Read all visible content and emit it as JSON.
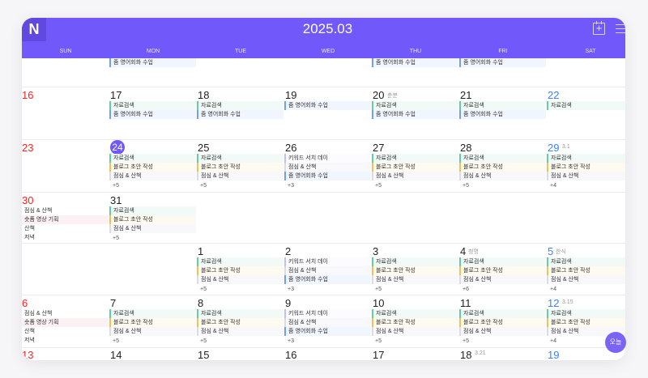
{
  "header": {
    "logo": "N",
    "title": "2025.03",
    "icons": [
      "calendar-plus-icon",
      "menu-icon"
    ]
  },
  "days_of_week": [
    "SUN",
    "MON",
    "TUE",
    "WED",
    "THU",
    "FRI",
    "SAT"
  ],
  "today_button": "오늘",
  "colors": {
    "accent": "#7158fb",
    "sunday": "#ff2020",
    "saturday": "#3b82f6"
  },
  "weeks": [
    {
      "partial": true,
      "cells": [
        {
          "events": []
        },
        {
          "events": [
            {
              "t": "줌 영어회화 수업",
              "c": "blue"
            }
          ]
        },
        {
          "events": []
        },
        {
          "events": []
        },
        {
          "events": [
            {
              "t": "줌 영어회화 수업",
              "c": "blue"
            }
          ]
        },
        {
          "events": [
            {
              "t": "줌 영어회화 수업",
              "c": "blue"
            }
          ]
        },
        {
          "events": []
        }
      ]
    },
    {
      "cells": [
        {
          "d": "16",
          "events": []
        },
        {
          "d": "17",
          "events": [
            {
              "t": "자료검색",
              "c": "green"
            },
            {
              "t": "줌 영어회화 수업",
              "c": "blue"
            }
          ]
        },
        {
          "d": "18",
          "events": [
            {
              "t": "자료검색",
              "c": "green"
            },
            {
              "t": "줌 영어회화 수업",
              "c": "blue"
            }
          ]
        },
        {
          "d": "19",
          "events": [
            {
              "t": "줌 영어회화 수업",
              "c": "blue"
            }
          ]
        },
        {
          "d": "20",
          "note": "춘분",
          "events": [
            {
              "t": "자료검색",
              "c": "green"
            },
            {
              "t": "줌 영어회화 수업",
              "c": "blue"
            }
          ]
        },
        {
          "d": "21",
          "events": [
            {
              "t": "자료검색",
              "c": "green"
            },
            {
              "t": "줌 영어회화 수업",
              "c": "blue"
            }
          ]
        },
        {
          "d": "22",
          "events": [
            {
              "t": "자료검색",
              "c": "green"
            }
          ]
        }
      ]
    },
    {
      "cells": [
        {
          "d": "23",
          "events": []
        },
        {
          "d": "24",
          "today": true,
          "events": [
            {
              "t": "자료검색",
              "c": "green"
            },
            {
              "t": "블로그 초안 작성",
              "c": "orange"
            },
            {
              "t": "점심 & 산책",
              "c": "gray"
            }
          ],
          "more": "+5"
        },
        {
          "d": "25",
          "events": [
            {
              "t": "자료검색",
              "c": "green"
            },
            {
              "t": "블로그 초안 작성",
              "c": "orange"
            },
            {
              "t": "점심 & 산책",
              "c": "gray"
            }
          ],
          "more": "+5"
        },
        {
          "d": "26",
          "events": [
            {
              "t": "키워드 서치 데이",
              "c": "purple"
            },
            {
              "t": "점심 & 산책",
              "c": "gray"
            },
            {
              "t": "줌 영어회화 수업",
              "c": "blue"
            }
          ],
          "more": "+3"
        },
        {
          "d": "27",
          "events": [
            {
              "t": "자료검색",
              "c": "green"
            },
            {
              "t": "블로그 초안 작성",
              "c": "orange"
            },
            {
              "t": "점심 & 산책",
              "c": "gray"
            }
          ],
          "more": "+5"
        },
        {
          "d": "28",
          "events": [
            {
              "t": "자료검색",
              "c": "green"
            },
            {
              "t": "블로그 초안 작성",
              "c": "orange"
            },
            {
              "t": "점심 & 산책",
              "c": "gray"
            }
          ],
          "more": "+5"
        },
        {
          "d": "29",
          "note": "3.1",
          "events": [
            {
              "t": "자료검색",
              "c": "green"
            },
            {
              "t": "블로그 초안 작성",
              "c": "orange"
            },
            {
              "t": "점심 & 산책",
              "c": "gray"
            }
          ],
          "more": "+4"
        }
      ]
    },
    {
      "cells": [
        {
          "d": "30",
          "events": [
            {
              "t": "점심 & 산책",
              "c": "plain"
            },
            {
              "t": "숏폼 영상 기획",
              "c": "pink"
            },
            {
              "t": "산책",
              "c": "plain"
            },
            {
              "t": "저녁",
              "c": "plain"
            }
          ]
        },
        {
          "d": "31",
          "events": [
            {
              "t": "자료검색",
              "c": "green"
            },
            {
              "t": "블로그 초안 작성",
              "c": "orange"
            },
            {
              "t": "점심 & 산책",
              "c": "gray"
            }
          ],
          "more": "+5"
        },
        {
          "events": []
        },
        {
          "events": []
        },
        {
          "events": []
        },
        {
          "events": []
        },
        {
          "events": []
        }
      ]
    },
    {
      "cells": [
        {
          "events": []
        },
        {
          "events": []
        },
        {
          "d": "1",
          "events": [
            {
              "t": "자료검색",
              "c": "green"
            },
            {
              "t": "블로그 초안 작성",
              "c": "orange"
            },
            {
              "t": "점심 & 산책",
              "c": "gray"
            }
          ],
          "more": "+5"
        },
        {
          "d": "2",
          "events": [
            {
              "t": "키워드 서치 데이",
              "c": "purple"
            },
            {
              "t": "점심 & 산책",
              "c": "gray"
            },
            {
              "t": "줌 영어회화 수업",
              "c": "blue"
            }
          ],
          "more": "+3"
        },
        {
          "d": "3",
          "events": [
            {
              "t": "자료검색",
              "c": "green"
            },
            {
              "t": "블로그 초안 작성",
              "c": "orange"
            },
            {
              "t": "점심 & 산책",
              "c": "gray"
            }
          ],
          "more": "+5"
        },
        {
          "d": "4",
          "note": "청명",
          "events": [
            {
              "t": "자료검색",
              "c": "green"
            },
            {
              "t": "블로그 초안 작성",
              "c": "orange"
            },
            {
              "t": "점심 & 산책",
              "c": "gray"
            }
          ],
          "more": "+6"
        },
        {
          "d": "5",
          "note": "한식",
          "events": [
            {
              "t": "자료검색",
              "c": "green"
            },
            {
              "t": "블로그 초안 작성",
              "c": "orange"
            },
            {
              "t": "점심 & 산책",
              "c": "gray"
            }
          ],
          "more": "+4"
        }
      ]
    },
    {
      "cells": [
        {
          "d": "6",
          "events": [
            {
              "t": "점심 & 산책",
              "c": "plain"
            },
            {
              "t": "숏폼 영상 기획",
              "c": "pink"
            },
            {
              "t": "산책",
              "c": "plain"
            },
            {
              "t": "저녁",
              "c": "plain"
            }
          ]
        },
        {
          "d": "7",
          "events": [
            {
              "t": "자료검색",
              "c": "green"
            },
            {
              "t": "블로그 초안 작성",
              "c": "orange"
            },
            {
              "t": "점심 & 산책",
              "c": "gray"
            }
          ],
          "more": "+5"
        },
        {
          "d": "8",
          "events": [
            {
              "t": "자료검색",
              "c": "green"
            },
            {
              "t": "블로그 초안 작성",
              "c": "orange"
            },
            {
              "t": "점심 & 산책",
              "c": "gray"
            }
          ],
          "more": "+5"
        },
        {
          "d": "9",
          "events": [
            {
              "t": "키워드 서치 데이",
              "c": "purple"
            },
            {
              "t": "점심 & 산책",
              "c": "gray"
            },
            {
              "t": "줌 영어회화 수업",
              "c": "blue"
            }
          ],
          "more": "+3"
        },
        {
          "d": "10",
          "events": [
            {
              "t": "자료검색",
              "c": "green"
            },
            {
              "t": "블로그 초안 작성",
              "c": "orange"
            },
            {
              "t": "점심 & 산책",
              "c": "gray"
            }
          ],
          "more": "+5"
        },
        {
          "d": "11",
          "events": [
            {
              "t": "자료검색",
              "c": "green"
            },
            {
              "t": "블로그 초안 작성",
              "c": "orange"
            },
            {
              "t": "점심 & 산책",
              "c": "gray"
            }
          ],
          "more": "+5"
        },
        {
          "d": "12",
          "note": "3.15",
          "events": [
            {
              "t": "자료검색",
              "c": "green"
            },
            {
              "t": "블로그 초안 작성",
              "c": "orange"
            },
            {
              "t": "점심 & 산책",
              "c": "gray"
            }
          ],
          "more": "+4"
        }
      ]
    },
    {
      "cells": [
        {
          "d": "13",
          "events": []
        },
        {
          "d": "14",
          "events": []
        },
        {
          "d": "15",
          "events": []
        },
        {
          "d": "16",
          "events": []
        },
        {
          "d": "17",
          "events": []
        },
        {
          "d": "18",
          "note": "3.21",
          "events": []
        },
        {
          "d": "19",
          "events": []
        }
      ]
    }
  ]
}
